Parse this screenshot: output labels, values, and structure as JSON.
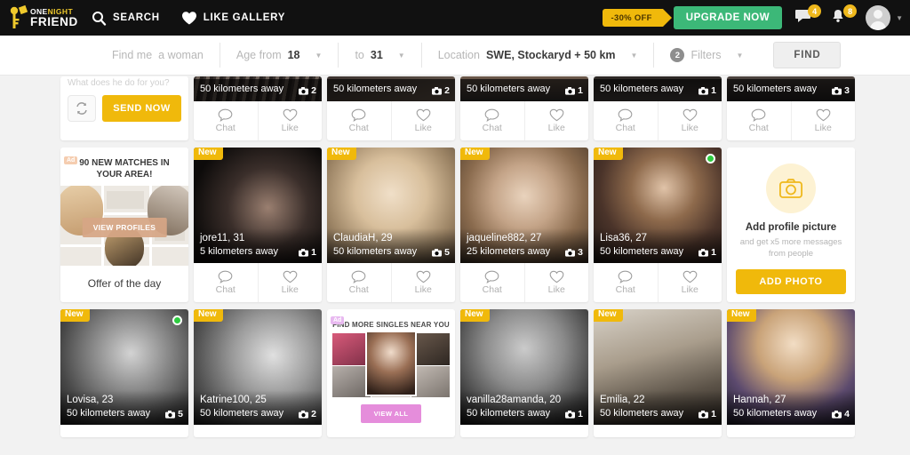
{
  "header": {
    "logo_line1_a": "ONE",
    "logo_line1_b": "NIGHT",
    "logo_line2": "FRIEND",
    "nav": [
      {
        "label": "SEARCH",
        "icon": "search-icon"
      },
      {
        "label": "LIKE GALLERY",
        "icon": "heart-icon"
      }
    ],
    "promo_label": "-30% OFF",
    "upgrade_label": "UPGRADE NOW",
    "messages_count": "4",
    "notifications_count": "8",
    "accent_yellow": "#f0b90b",
    "accent_green": "#3cb878"
  },
  "searchbar": {
    "find_me_label": "Find me",
    "find_me_value": "a woman",
    "age_from_label": "Age from",
    "age_from_value": "18",
    "age_to_label": "to",
    "age_to_value": "31",
    "location_label": "Location",
    "location_value": "SWE, Stockaryd + 50 km",
    "filters_count": "2",
    "filters_label": "Filters",
    "find_button": "FIND"
  },
  "labels": {
    "chat": "Chat",
    "like": "Like",
    "new": "New",
    "ad": "Ad",
    "distance_50": "50 kilometers away"
  },
  "send_card": {
    "ghost_text": "What does he do for you?",
    "refresh_icon": "refresh-icon",
    "send_label": "SEND NOW"
  },
  "offer_card": {
    "ad_tag": "Ad",
    "headline": "90 NEW MATCHES IN YOUR AREA!",
    "cta": "VIEW PROFILES",
    "footer": "Offer of the day"
  },
  "add_photo_card": {
    "icon": "camera-icon",
    "title": "Add profile picture",
    "subtitle": "and get x5 more messages from people",
    "button": "ADD PHOTO"
  },
  "bottom_ad_card": {
    "ad_tag": "Ad",
    "headline": "FIND MORE SINGLES NEAR YOU",
    "cta": "VIEW ALL"
  },
  "rows": {
    "top_partial": [
      {
        "distance": "50 kilometers away",
        "photos": "2",
        "chat": "Chat",
        "like": "Like"
      },
      {
        "distance": "50 kilometers away",
        "photos": "2",
        "chat": "Chat",
        "like": "Like"
      },
      {
        "distance": "50 kilometers away",
        "photos": "1",
        "chat": "Chat",
        "like": "Like"
      },
      {
        "distance": "50 kilometers away",
        "photos": "1",
        "chat": "Chat",
        "like": "Like"
      },
      {
        "distance": "50 kilometers away",
        "photos": "3",
        "chat": "Chat",
        "like": "Like"
      }
    ],
    "middle": [
      {
        "name": "jore11",
        "age": "31",
        "distance": "5 kilometers away",
        "photos": "1",
        "new": "New",
        "online": false,
        "chat": "Chat",
        "like": "Like"
      },
      {
        "name": "ClaudiaH",
        "age": "29",
        "distance": "50 kilometers away",
        "photos": "5",
        "new": "New",
        "online": false,
        "chat": "Chat",
        "like": "Like"
      },
      {
        "name": "jaqueline882",
        "age": "27",
        "distance": "25 kilometers away",
        "photos": "3",
        "new": "New",
        "online": false,
        "chat": "Chat",
        "like": "Like"
      },
      {
        "name": "Lisa36",
        "age": "27",
        "distance": "50 kilometers away",
        "photos": "1",
        "new": "New",
        "online": true,
        "chat": "Chat",
        "like": "Like"
      }
    ],
    "bottom": [
      {
        "name": "Lovisa",
        "age": "23",
        "distance": "50 kilometers away",
        "photos": "5",
        "new": "New",
        "online": true
      },
      {
        "name": "Katrine100",
        "age": "25",
        "distance": "50 kilometers away",
        "photos": "2",
        "new": "New",
        "online": false
      },
      {
        "name": "vanilla28amanda",
        "age": "20",
        "distance": "50 kilometers away",
        "photos": "1",
        "new": "New",
        "online": false
      },
      {
        "name": "Emilia",
        "age": "22",
        "distance": "50 kilometers away",
        "photos": "1",
        "new": "New",
        "online": false
      },
      {
        "name": "Hannah",
        "age": "27",
        "distance": "50 kilometers away",
        "photos": "4",
        "new": "New",
        "online": false
      }
    ]
  }
}
